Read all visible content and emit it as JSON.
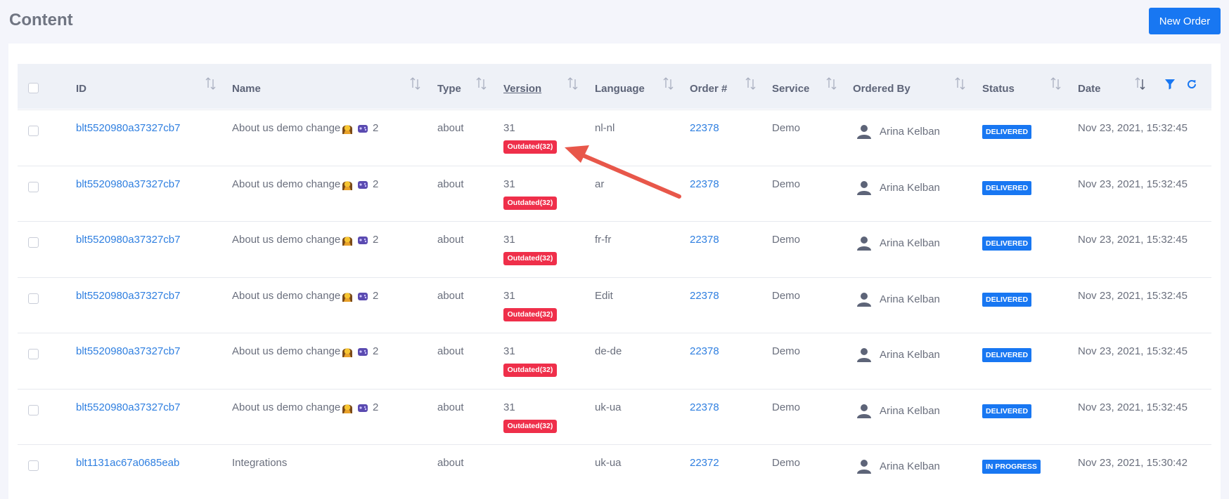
{
  "page": {
    "title": "Content",
    "new_order_label": "New Order"
  },
  "columns": [
    "ID",
    "Name",
    "Type",
    "Version",
    "Language",
    "Order #",
    "Service",
    "Ordered By",
    "Status",
    "Date"
  ],
  "rows": [
    {
      "id": "blt5520980a37327cb7",
      "name": "About us demo change",
      "count": "2",
      "type": "about",
      "version": "31",
      "badge": "Outdated(32)",
      "language": "nl-nl",
      "order": "22378",
      "service": "Demo",
      "ordered_by": "Arina Kelban",
      "status": "DELIVERED",
      "date": "Nov 23, 2021, 15:32:45"
    },
    {
      "id": "blt5520980a37327cb7",
      "name": "About us demo change",
      "count": "2",
      "type": "about",
      "version": "31",
      "badge": "Outdated(32)",
      "language": "ar",
      "order": "22378",
      "service": "Demo",
      "ordered_by": "Arina Kelban",
      "status": "DELIVERED",
      "date": "Nov 23, 2021, 15:32:45"
    },
    {
      "id": "blt5520980a37327cb7",
      "name": "About us demo change",
      "count": "2",
      "type": "about",
      "version": "31",
      "badge": "Outdated(32)",
      "language": "fr-fr",
      "order": "22378",
      "service": "Demo",
      "ordered_by": "Arina Kelban",
      "status": "DELIVERED",
      "date": "Nov 23, 2021, 15:32:45"
    },
    {
      "id": "blt5520980a37327cb7",
      "name": "About us demo change",
      "count": "2",
      "type": "about",
      "version": "31",
      "badge": "Outdated(32)",
      "language": "Edit",
      "order": "22378",
      "service": "Demo",
      "ordered_by": "Arina Kelban",
      "status": "DELIVERED",
      "date": "Nov 23, 2021, 15:32:45"
    },
    {
      "id": "blt5520980a37327cb7",
      "name": "About us demo change",
      "count": "2",
      "type": "about",
      "version": "31",
      "badge": "Outdated(32)",
      "language": "de-de",
      "order": "22378",
      "service": "Demo",
      "ordered_by": "Arina Kelban",
      "status": "DELIVERED",
      "date": "Nov 23, 2021, 15:32:45"
    },
    {
      "id": "blt5520980a37327cb7",
      "name": "About us demo change",
      "count": "2",
      "type": "about",
      "version": "31",
      "badge": "Outdated(32)",
      "language": "uk-ua",
      "order": "22378",
      "service": "Demo",
      "ordered_by": "Arina Kelban",
      "status": "DELIVERED",
      "date": "Nov 23, 2021, 15:32:45"
    },
    {
      "id": "blt1131ac67a0685eab",
      "name": "Integrations",
      "count": "",
      "type": "about",
      "version": "",
      "badge": "",
      "language": "uk-ua",
      "order": "22372",
      "service": "Demo",
      "ordered_by": "Arina Kelban",
      "status": "IN PROGRESS",
      "date": "Nov 23, 2021, 15:30:42"
    }
  ],
  "colors": {
    "accent": "#1877f2",
    "outdated": "#ef2f4a",
    "link": "#2f7fe0",
    "arrow": "#e8574a"
  },
  "icons": [
    "sort-icon",
    "filter-icon",
    "refresh-icon",
    "user-avatar-icon",
    "person-gesture-emoji-icon",
    "video-game-emoji-icon"
  ]
}
